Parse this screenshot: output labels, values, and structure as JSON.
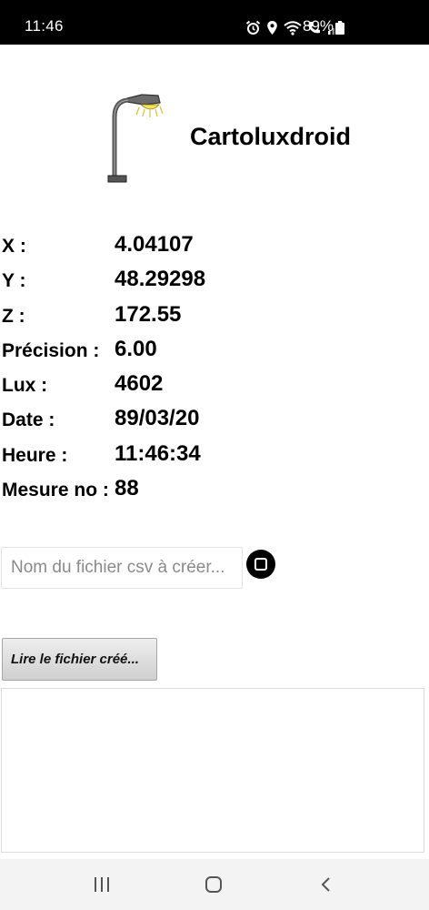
{
  "status_bar": {
    "time": "11:46",
    "battery": "89%",
    "icons": [
      "alarm-icon",
      "location-icon",
      "wifi-icon",
      "call-icon",
      "signal-icon",
      "battery-icon"
    ]
  },
  "header": {
    "title": "Cartoluxdroid",
    "logo": "street-lamp-icon"
  },
  "readings": [
    {
      "label": "X :",
      "value": "4.04107"
    },
    {
      "label": "Y :",
      "value": "48.29298"
    },
    {
      "label": "Z :",
      "value": "172.55"
    },
    {
      "label": "Précision :",
      "value": "6.00"
    },
    {
      "label": "Lux :",
      "value": "4602"
    },
    {
      "label": "Date :",
      "value": "89/03/20"
    },
    {
      "label": "Heure :",
      "value": "11:46:34"
    },
    {
      "label": "Mesure no :",
      "value": "88"
    }
  ],
  "file_form": {
    "filename_value": "",
    "filename_placeholder": "Nom du fichier csv à créer...",
    "record_icon": "stop-icon",
    "read_button_label": "Lire le fichier créé..."
  },
  "output": {
    "text": ""
  },
  "nav_bar": {
    "icons": [
      "recent-apps-icon",
      "home-icon",
      "back-icon"
    ]
  },
  "colors": {
    "status_bar_bg": "#000000",
    "nav_bar_bg": "#f3f3f3",
    "lamp_light": "#f2e15a"
  }
}
